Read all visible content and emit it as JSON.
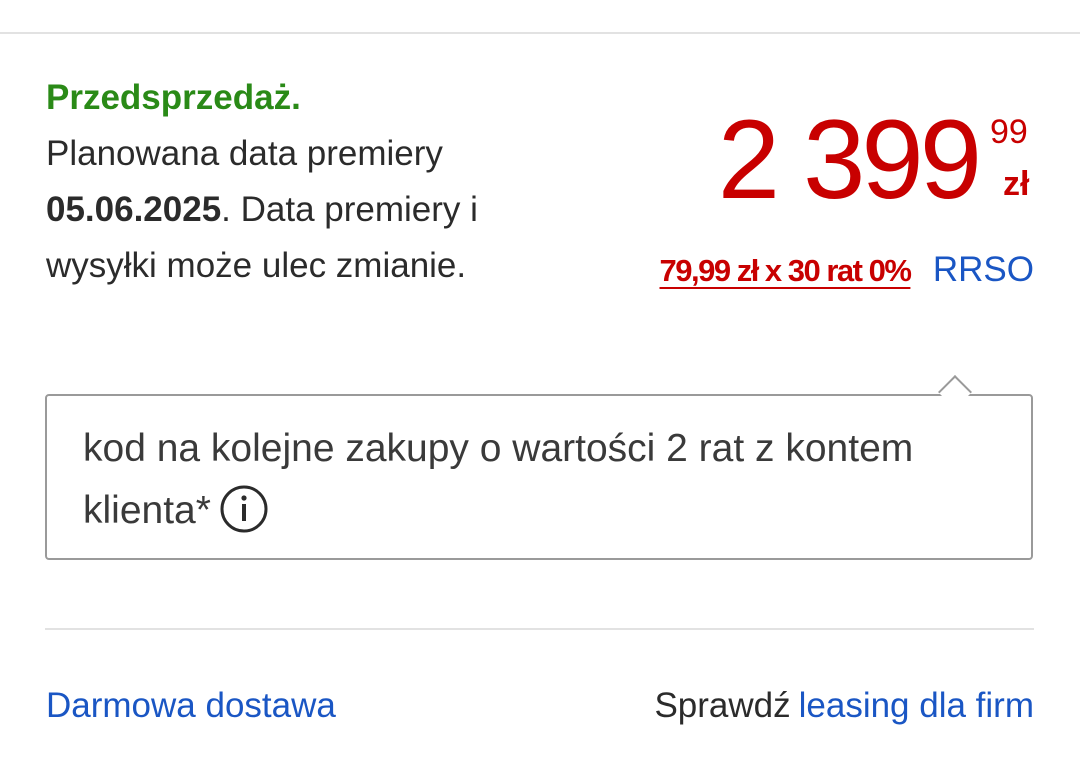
{
  "availability": {
    "status": "Przedsprzedaż.",
    "release_prefix": "Planowana data premiery",
    "release_date": "05.06.2025",
    "release_suffix": ". Data premiery i wysyłki może ulec zmianie."
  },
  "price": {
    "main": "2 399",
    "cents": "99",
    "currency": "zł"
  },
  "installments": {
    "offer": "79,99 zł x 30 rat 0%",
    "rrso_label": "RRSO"
  },
  "promo": {
    "text": "kod na kolejne zakupy o wartości 2 rat z kontem klienta*",
    "info_icon": "info-circle-icon"
  },
  "footer": {
    "free_delivery": "Darmowa dostawa",
    "leasing_prefix": "Sprawdź",
    "leasing_link": "leasing dla firm"
  },
  "colors": {
    "preorder_green": "#2a8a17",
    "price_red": "#c80000",
    "link_blue": "#1a56c4"
  }
}
